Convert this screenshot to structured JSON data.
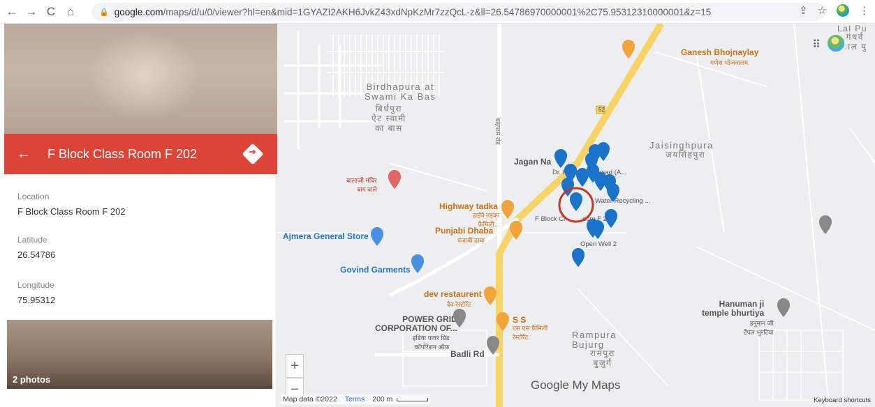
{
  "browser": {
    "url_domain": "google.com",
    "url_path": "/maps/d/u/0/viewer?hl=en&mid=1GYAZI2AKH6JvkZ43xdNpKzMr7zzQcL-z&ll=26.54786970000001%2C75.95312310000001&z=15"
  },
  "sidebar": {
    "title": "F Block Class Room F 202",
    "fields": [
      {
        "label": "Location",
        "value": "F Block Class Room F 202"
      },
      {
        "label": "Latitude",
        "value": "26.54786"
      },
      {
        "label": "Longitude",
        "value": "75.95312"
      }
    ],
    "photos_count": "2 photos"
  },
  "map": {
    "places": [
      {
        "name": "Birdhapura at\nSwami Ka Bas",
        "sub": "बिर्धपुरा\nऐट स्वामी\nका बास"
      },
      {
        "name": "Jaisinghpura",
        "sub": "जयसिंहपुरा"
      },
      {
        "name": "Rampura\nBujurg",
        "sub": "रामपुरा\nबुज़ुर्ग"
      },
      {
        "name": "Lal Pu",
        "sub": "गंधर्व\nाल पु"
      }
    ],
    "pois": {
      "ganesh": "Ganesh Bhojnaylay",
      "ganesh_sub": "गणेश भोजनालय",
      "balaji": "बालाजी मंदिर\nबाग वाले",
      "highway": "Highway tadka",
      "highway_sub": "हाईवे तड़का\nफ़ैमिली...",
      "punjabi": "Punjabi Dhaba",
      "punjabi_sub": "पंजाबी ढाबा",
      "ajmera": "Ajmera General Store",
      "govind": "Govind Garments",
      "dev": "dev restaurent",
      "dev_sub": "देव रेस्टोरेंट",
      "powergrid": "POWER GRID\nCORPORATION OF...",
      "powergrid_sub": "इंडिया पावर ग्रिड\nकॉर्पोरेशन ऑफ़",
      "ss": "S S",
      "ss_sub": "एस एस फ़ैमिली\nरेस्टोरेंट",
      "badli": "Badli Rd",
      "hanuman": "Hanuman ji\ntemple bhurtiya",
      "hanuman_sub": "हनुमान जी\nटेंपल भुरटिया",
      "jagan": "Jagan Na",
      "rajendra": "Dr. Rajendra Prasad (A...",
      "water": "Water Recycling ...",
      "fblock": "F Block Cl",
      "fblock2": "oom F 202",
      "openwell": "Open Well 2",
      "road52": "52",
      "road_v": "बाइपास रोड"
    },
    "footer": {
      "data": "Map data ©2022",
      "terms": "Terms",
      "scale": "200 m",
      "shortcuts": "Keyboard shortcuts"
    },
    "logo": "Google My Maps"
  },
  "colors": {
    "accent": "#db4437",
    "pin": "#1a73c9",
    "road_major": "#f8d468"
  }
}
